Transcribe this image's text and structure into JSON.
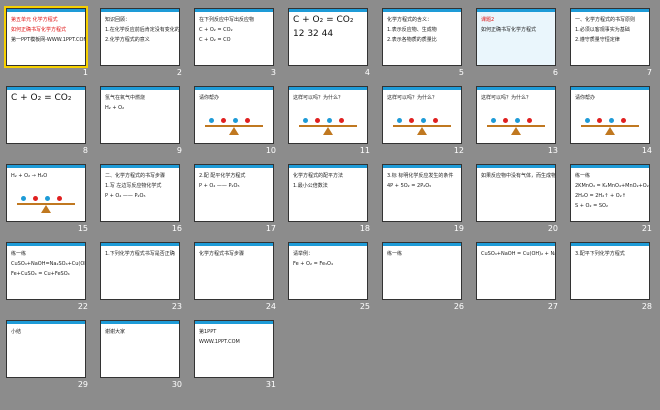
{
  "slides": [
    {
      "num": "1",
      "lines": [
        "第五单元 化学方程式",
        "如何正确书写化学方程式",
        "第一PPT模板网-WWW.1PPT.COM"
      ]
    },
    {
      "num": "2",
      "lines": [
        "知识回顾：",
        "1.在化学反应前后肯定没有变化的是",
        "2.化学方程式的意义"
      ]
    },
    {
      "num": "3",
      "lines": [
        "在下列反应中写出反应物",
        "C + O₂ = CO₂",
        "C + O₂ = CO"
      ]
    },
    {
      "num": "4",
      "lines": [
        "C + O₂ = CO₂",
        "12   32   44"
      ]
    },
    {
      "num": "5",
      "lines": [
        "化学方程式的含义：",
        "1.表示反应物、生成物",
        "2.表示各物质的质量比"
      ]
    },
    {
      "num": "6",
      "lines": [
        "课题2",
        "如何正确书写化学方程式"
      ]
    },
    {
      "num": "7",
      "lines": [
        "一、化学方程式的书写原则",
        "1.必须以客观事实为基础",
        "2.遵守质量守恒定律"
      ]
    },
    {
      "num": "8",
      "lines": [
        "C + O₂ = CO₂"
      ]
    },
    {
      "num": "9",
      "lines": [
        "氢气在氧气中燃烧",
        "H₂ + O₂"
      ]
    },
    {
      "num": "10",
      "lines": [
        "请你帮办"
      ]
    },
    {
      "num": "11",
      "lines": [
        "这样可以吗？为什么？"
      ]
    },
    {
      "num": "12",
      "lines": [
        "这样可以吗？为什么？"
      ]
    },
    {
      "num": "13",
      "lines": [
        "这样可以吗？为什么？"
      ]
    },
    {
      "num": "14",
      "lines": [
        "请你帮办"
      ]
    },
    {
      "num": "15",
      "lines": [
        "H₂ + O₂ → H₂O"
      ]
    },
    {
      "num": "16",
      "lines": [
        "二、化学方程式的书写步骤",
        "1.写 左边写反应物化学式",
        "P + O₂ —— P₂O₅"
      ]
    },
    {
      "num": "17",
      "lines": [
        "2.配 配平化学方程式",
        "P + O₂ —— P₂O₅"
      ]
    },
    {
      "num": "18",
      "lines": [
        "化学方程式的配平方法",
        "1.最小公倍数法"
      ]
    },
    {
      "num": "19",
      "lines": [
        "3.标 标明化学反应发生的条件",
        "4P + 5O₂ = 2P₂O₅"
      ]
    },
    {
      "num": "20",
      "lines": [
        "如果反应物中没有气体，而生成物中出现了气体，需在气体物质的化学式右边注↑号"
      ]
    },
    {
      "num": "21",
      "lines": [
        "练一练",
        "2KMnO₄ = K₂MnO₄+MnO₂+O₂↑",
        "2H₂O = 2H₂↑ + O₂↑",
        "S + O₂ = SO₂"
      ]
    },
    {
      "num": "22",
      "lines": [
        "练一练",
        "CuSO₄+NaOH=Na₂SO₄+Cu(OH)₂",
        "Fe+CuSO₄ = Cu+FeSO₄"
      ]
    },
    {
      "num": "23",
      "lines": [
        "1.下列化学方程式书写是否正确"
      ]
    },
    {
      "num": "24",
      "lines": [
        "化学方程式书写步骤"
      ]
    },
    {
      "num": "25",
      "lines": [
        "请举例：",
        "Fe + O₂ = Fe₃O₄"
      ]
    },
    {
      "num": "26",
      "lines": [
        "练一练"
      ]
    },
    {
      "num": "27",
      "lines": [
        "CuSO₄+NaOH = Cu(OH)₂ + Na₂SO₄"
      ]
    },
    {
      "num": "28",
      "lines": [
        "3.配平下列化学方程式"
      ]
    },
    {
      "num": "29",
      "lines": [
        "小结"
      ]
    },
    {
      "num": "30",
      "lines": [
        "谢谢大家"
      ]
    },
    {
      "num": "31",
      "lines": [
        "第1PPT",
        "WWW.1PPT.COM"
      ]
    }
  ]
}
